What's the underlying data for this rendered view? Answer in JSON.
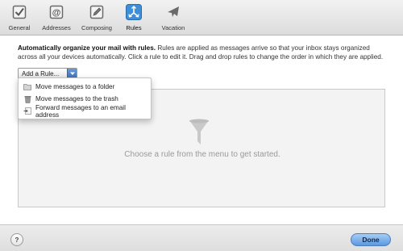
{
  "toolbar": {
    "tabs": [
      {
        "id": "general",
        "label": "General",
        "icon": "checkbox-icon"
      },
      {
        "id": "addresses",
        "label": "Addresses",
        "icon": "at-sign-icon"
      },
      {
        "id": "composing",
        "label": "Composing",
        "icon": "compose-pencil-icon"
      },
      {
        "id": "rules",
        "label": "Rules",
        "icon": "rules-arrows-icon",
        "active": true
      },
      {
        "id": "vacation",
        "label": "Vacation",
        "icon": "airplane-icon"
      }
    ]
  },
  "description": {
    "bold": "Automatically organize your mail with rules.",
    "text": " Rules are applied as messages arrive so that your inbox stays organized across all your devices automatically. Click a rule to edit it. Drag and drop rules to change the order in which they are applied."
  },
  "add_rule": {
    "label": "Add a Rule..."
  },
  "menu": {
    "items": [
      {
        "label": "Move messages to a folder",
        "icon": "folder-icon"
      },
      {
        "label": "Move messages to the trash",
        "icon": "trash-icon"
      },
      {
        "label": "Forward messages to an email address",
        "icon": "forward-icon"
      }
    ]
  },
  "rules_area": {
    "empty_message": "Choose a rule from the menu to get started.",
    "icon": "funnel-icon"
  },
  "footer": {
    "help_label": "?",
    "done_label": "Done"
  },
  "colors": {
    "accent": "#5a98e0",
    "rules_tab_icon_bg": "#3d8fd9"
  }
}
